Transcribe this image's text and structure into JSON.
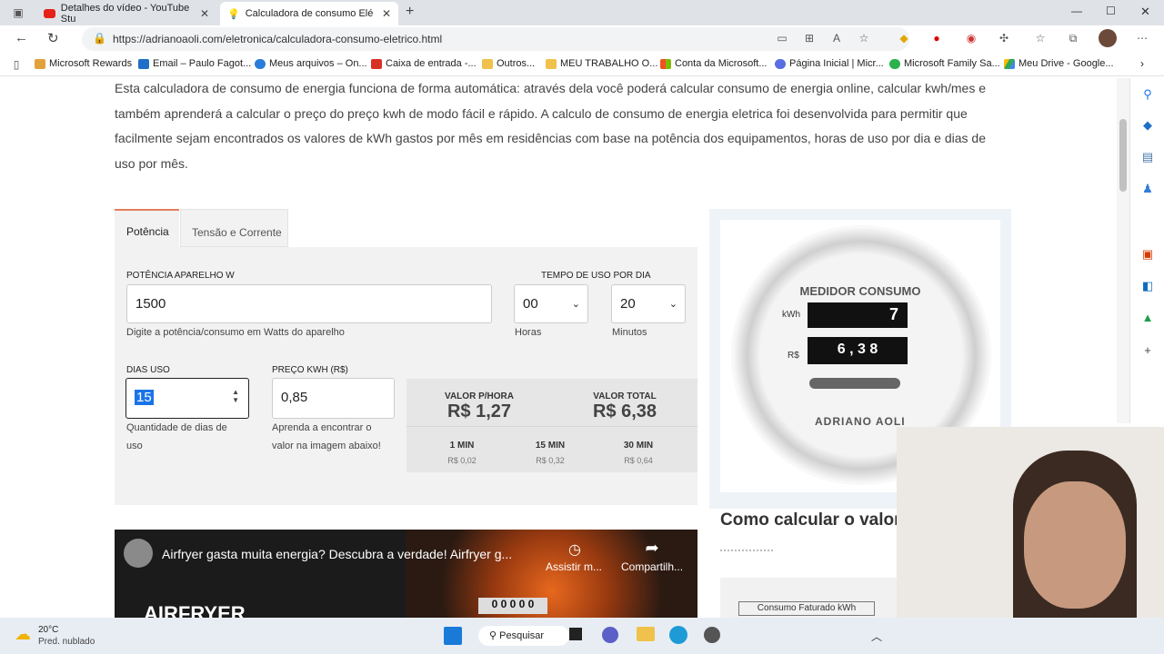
{
  "browser": {
    "tabs": [
      {
        "title": "Detalhes do vídeo - YouTube Stu",
        "icon": "youtube-icon"
      },
      {
        "title": "Calculadora de consumo Elé",
        "icon": "lightbulb-icon"
      }
    ],
    "url": "https://adrianoaoli.com/eletronica/calculadora-consumo-eletrico.html",
    "bookmarks": [
      "Microsoft Rewards",
      "Email – Paulo Fagot...",
      "Meus arquivos – On...",
      "Caixa de entrada -...",
      "Outros...",
      "MEU TRABALHO O...",
      "Conta da Microsoft...",
      "Página Inicial | Micr...",
      "Microsoft Family Sa...",
      "Meu Drive - Google..."
    ]
  },
  "intro": "Esta calculadora de consumo de energia funciona de forma automática: através dela você poderá calcular consumo de energia online, calcular kwh/mes e também aprenderá a calcular o preço do preço kwh de modo fácil e rápido. A calculo de consumo de energia eletrica foi desenvolvida para permitir que facilmente sejam encontrados os valores de kWh gastos por mês em residências com base na potência dos equipamentos, horas de uso por dia e dias de uso por mês.",
  "calc": {
    "tab_power": "Potência",
    "tab_voltage": "Tensão e Corrente",
    "power_label": "POTÊNCIA APARELHO W",
    "power_value": "1500",
    "power_help": "Digite a potência/consumo em Watts do aparelho",
    "time_label": "TEMPO DE USO POR DIA",
    "hours_value": "00",
    "hours_label": "Horas",
    "minutes_value": "20",
    "minutes_label": "Minutos",
    "days_label": "DIAS USO",
    "days_value": "15",
    "days_help": "Quantidade de dias de uso",
    "price_label": "PREÇO KWH (R$)",
    "price_value": "0,85",
    "price_help": "Aprenda a encontrar o valor na imagem abaixo!",
    "hour_value_label": "VALOR P/HORA",
    "hour_value": "R$ 1,27",
    "total_label": "VALOR TOTAL",
    "total_value": "R$ 6,38",
    "min1_label": "1 MIN",
    "min1_value": "R$ 0,02",
    "min15_label": "15 MIN",
    "min15_value": "R$ 0,32",
    "min30_label": "30 MIN",
    "min30_value": "R$ 0,64"
  },
  "meter": {
    "title": "MEDIDOR CONSUMO",
    "kwh_label": "kWh",
    "kwh_value": "7",
    "rs_label": "R$",
    "rs_value": "6 , 3 8",
    "brand": "ADRIANO AOLI"
  },
  "howto": "Como calcular o valor",
  "video": {
    "title": "Airfryer gasta muita energia? Descubra a verdade! Airfryer g...",
    "watch_later": "Assistir m...",
    "share": "Compartilh...",
    "overlay_text": "AIRFRYER",
    "counter": "0 0 0 0 0"
  },
  "taskbar": {
    "temp": "20°C",
    "weather": "Pred. nublado",
    "search": "Pesquisar"
  },
  "colors": {
    "accent": "#e57f5a",
    "tab_bg": "#dfe3e8"
  }
}
